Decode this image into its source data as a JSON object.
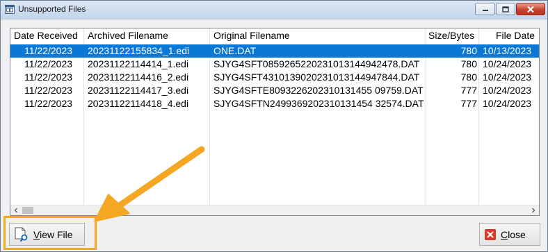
{
  "window": {
    "title": "Unsupported Files",
    "buttons": {
      "minimize": "minimize-icon",
      "maximize": "maximize-icon",
      "close": "close-x-icon"
    }
  },
  "table": {
    "columns": [
      "Date Received",
      "Archived Filename",
      "Original Filename",
      "Size/Bytes",
      "File Date"
    ],
    "rows": [
      {
        "date_received": "11/22/2023",
        "archived": "20231122155834_1.edi",
        "original": "ONE.DAT",
        "size": "780",
        "file_date": "10/13/2023",
        "selected": true
      },
      {
        "date_received": "11/22/2023",
        "archived": "20231122114414_1.edi",
        "original": "SJYG4SFT0859265220231013144942478.DAT",
        "size": "780",
        "file_date": "10/24/2023",
        "selected": false
      },
      {
        "date_received": "11/22/2023",
        "archived": "20231122114416_2.edi",
        "original": "SJYG4SFT4310139020231013144947844.DAT",
        "size": "780",
        "file_date": "10/24/2023",
        "selected": false
      },
      {
        "date_received": "11/22/2023",
        "archived": "20231122114417_3.edi",
        "original": "SJYG4SFTE8093226202310131455 09759.DAT",
        "size": "777",
        "file_date": "10/24/2023",
        "selected": false
      },
      {
        "date_received": "11/22/2023",
        "archived": "20231122114418_4.edi",
        "original": "SJYG4SFTN2499369202310131454 32574.DAT",
        "size": "777",
        "file_date": "10/24/2023",
        "selected": false
      }
    ]
  },
  "footer": {
    "view_file": {
      "label_underlined": "V",
      "label_rest": "iew File",
      "icon": "view-document-icon"
    },
    "close": {
      "label_underlined": "C",
      "label_rest": "lose",
      "icon": "close-red-x-icon"
    }
  },
  "annotation": {
    "color": "#f5a623"
  },
  "colors": {
    "selection": "#0a78d7"
  }
}
